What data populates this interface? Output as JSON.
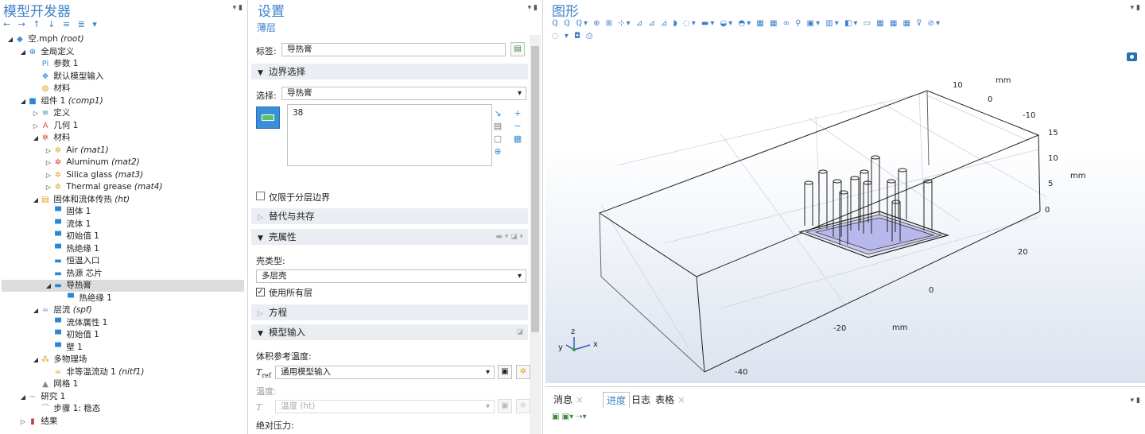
{
  "model": {
    "title": "模型开发器",
    "toolbar": "← → ↑ ↓ ≡ ≣ ▾",
    "tree": [
      {
        "t": "空.mph ",
        "i": "(root)",
        "ic": "◆",
        "exp": "◢",
        "lv": 0,
        "ic_color": "#3a8fd8"
      },
      {
        "t": "全局定义",
        "ic": "⊕",
        "exp": "◢",
        "lv": 1,
        "ic_color": "#2a86d6"
      },
      {
        "t": "参数 1",
        "ic": "Pi",
        "exp": "",
        "lv": 2,
        "ic_color": "#3a8fd8"
      },
      {
        "t": "默认模型输入",
        "ic": "❖",
        "exp": "",
        "lv": 2,
        "ic_color": "#3a8fd8"
      },
      {
        "t": "材料",
        "ic": "◍",
        "exp": "",
        "lv": 2,
        "ic_color": "#e6a020"
      },
      {
        "t": "组件 1 ",
        "i": "(comp1)",
        "ic": "■",
        "exp": "◢",
        "lv": 1,
        "ic_color": "#2a86d6"
      },
      {
        "t": "定义",
        "ic": "≡",
        "exp": "▷",
        "lv": 2,
        "ic_color": "#2a86d6"
      },
      {
        "t": "几何 1",
        "ic": "A",
        "exp": "▷",
        "lv": 2,
        "ic_color": "#d85a5a"
      },
      {
        "t": "材料",
        "ic": "✲",
        "exp": "◢",
        "lv": 2,
        "ic_color": "#d8403a"
      },
      {
        "t": "Air ",
        "i": "(mat1)",
        "ic": "✲",
        "exp": "▷",
        "lv": 3,
        "ic_color": "#e6a020"
      },
      {
        "t": "Aluminum ",
        "i": "(mat2)",
        "ic": "✲",
        "exp": "▷",
        "lv": 3,
        "ic_color": "#d8403a"
      },
      {
        "t": "Silica glass ",
        "i": "(mat3)",
        "ic": "✲",
        "exp": "▷",
        "lv": 3,
        "ic_color": "#e6a020"
      },
      {
        "t": "Thermal grease ",
        "i": "(mat4)",
        "ic": "✲",
        "exp": "▷",
        "lv": 3,
        "ic_color": "#e6a020"
      },
      {
        "t": "固体和流体传热 ",
        "i": "(ht)",
        "ic": "▤",
        "exp": "◢",
        "lv": 2,
        "ic_color": "#e6a020"
      },
      {
        "t": "固体 1",
        "ic": "▀",
        "exp": "",
        "lv": 3,
        "ic_color": "#2a86d6"
      },
      {
        "t": "流体 1",
        "ic": "▀",
        "exp": "",
        "lv": 3,
        "ic_color": "#2a86d6"
      },
      {
        "t": "初始值 1",
        "ic": "▀",
        "exp": "",
        "lv": 3,
        "ic_color": "#2a86d6"
      },
      {
        "t": "热绝缘 1",
        "ic": "▀",
        "exp": "",
        "lv": 3,
        "ic_color": "#2a86d6"
      },
      {
        "t": "恒温入口",
        "ic": "▬",
        "exp": "",
        "lv": 3,
        "ic_color": "#2a86d6"
      },
      {
        "t": "热源 芯片",
        "ic": "▬",
        "exp": "",
        "lv": 3,
        "ic_color": "#2a86d6"
      },
      {
        "t": "导热膏",
        "ic": "▬",
        "exp": "◢",
        "lv": 3,
        "ic_color": "#2a86d6",
        "sel": true
      },
      {
        "t": "热绝缘 1",
        "ic": "▀",
        "exp": "",
        "lv": 4,
        "ic_color": "#2a86d6"
      },
      {
        "t": "层流 ",
        "i": "(spf)",
        "ic": "≈",
        "exp": "◢",
        "lv": 2,
        "ic_color": "#6a9ad6"
      },
      {
        "t": "流体属性 1",
        "ic": "▀",
        "exp": "",
        "lv": 3,
        "ic_color": "#2a86d6"
      },
      {
        "t": "初始值 1",
        "ic": "▀",
        "exp": "",
        "lv": 3,
        "ic_color": "#2a86d6"
      },
      {
        "t": "壁 1",
        "ic": "▀",
        "exp": "",
        "lv": 3,
        "ic_color": "#2a86d6"
      },
      {
        "t": "多物理场",
        "ic": "⁂",
        "exp": "◢",
        "lv": 2,
        "ic_color": "#e6a020"
      },
      {
        "t": "非等温流动 1 ",
        "i": "(nitf1)",
        "ic": "≈",
        "exp": "",
        "lv": 3,
        "ic_color": "#e6a020"
      },
      {
        "t": "网格 1",
        "ic": "▲",
        "exp": "",
        "lv": 2,
        "ic_color": "#888888"
      },
      {
        "t": "研究 1",
        "ic": "~",
        "exp": "◢",
        "lv": 1,
        "ic_color": "#6a9ad6"
      },
      {
        "t": "步骤 1: 稳态",
        "ic": "⌒",
        "exp": "",
        "lv": 2,
        "ic_color": "#6a9ad6"
      },
      {
        "t": "结果",
        "ic": "▮",
        "exp": "▷",
        "lv": 1,
        "ic_color": "#c04040"
      }
    ]
  },
  "settings": {
    "title": "设置",
    "subtitle": "薄层",
    "label_caption": "标签:",
    "label_value": "导热膏",
    "sec_boundary": "边界选择",
    "select_caption": "选择:",
    "select_value": "导热膏",
    "selection_item": "38",
    "only_layer_boundaries": "仅限于分层边界",
    "sec_override": "替代与共存",
    "sec_shell": "壳属性",
    "shell_type_caption": "壳类型:",
    "shell_type_value": "多层壳",
    "use_all_layers": "使用所有层",
    "sec_equation": "方程",
    "sec_model_input": "模型输入",
    "ref_temp_caption": "体积参考温度:",
    "tref_symbol": "T",
    "tref_sub": "ref",
    "tref_value": "通用模型输入",
    "temp_caption": "温度:",
    "t_symbol": "T",
    "t_value": "温度 (ht)",
    "abs_pressure_caption": "绝对压力:"
  },
  "graphics": {
    "title": "图形",
    "toolbar_row1": "ℚ ℚ ℚ▾ ⊕ ⊞ ⊹▾ ⊿ ⊿ ⊿ ◗ ◌▾ ▬▾ ◒▾ ◓▾ ▦ ▦ ∞ ⚲ ▣▾ ▥▾ ◧▾ ▭ ▦ ▦ ▦ ⊽ ⊘▾",
    "toolbar_row2": "◌ ▾ ◘ ⎙",
    "axis_labels": {
      "top_ticks": [
        "10",
        "0",
        "-10"
      ],
      "top_unit": "mm",
      "right_ticks": [
        "15",
        "10",
        "5",
        "0"
      ],
      "right_unit": "mm",
      "depth_ticks": [
        "20",
        "0",
        "-20",
        "-40"
      ],
      "depth_unit": "mm"
    },
    "triad": {
      "z": "z",
      "y": "y",
      "x": "x"
    },
    "tabs": [
      {
        "label": "消息",
        "closable": true
      },
      {
        "label": "进度",
        "closable": false,
        "active": true
      },
      {
        "label": "日志",
        "closable": false
      },
      {
        "label": "表格",
        "closable": true
      }
    ],
    "bottom_toolbar": "▣ ▣▾ ⇢▾"
  },
  "colors": {
    "accent": "#3c82c8",
    "section_bg": "#eaeef3",
    "selected_row": "#dcdcdc",
    "highlight_face": "#c8c8f0"
  }
}
